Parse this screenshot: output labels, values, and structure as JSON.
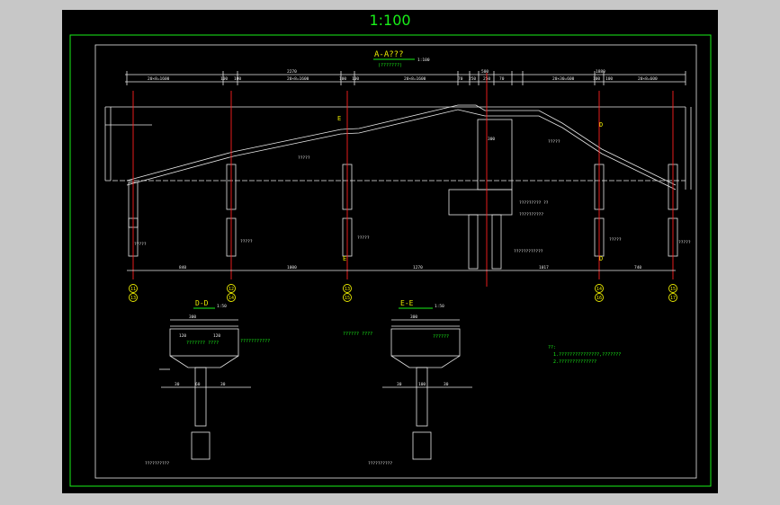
{
  "drawing": {
    "scale_title": "1:100",
    "section_aa": {
      "title": "A-A???",
      "subtitle": "(???????)",
      "scale": "1:100"
    },
    "section_dd": {
      "title": "D-D",
      "scale": "1:50"
    },
    "section_ee": {
      "title": "E-E",
      "scale": "1:50"
    },
    "top_dims": [
      "2270",
      "500",
      "1880"
    ],
    "sub_dims": [
      "20×8=1600",
      "100",
      "100",
      "20×8=1600",
      "100",
      "100",
      "20×8=1600",
      "70",
      "250",
      "250",
      "70",
      "20×30=600",
      "100",
      "100",
      "20×8=600"
    ],
    "bottom_dims": [
      "840",
      "1000",
      "1270",
      "1017",
      "740"
    ],
    "axis_labels": [
      {
        "top": "11",
        "bot": "13"
      },
      {
        "top": "12",
        "bot": "14"
      },
      {
        "top": "13",
        "bot": "15"
      },
      {
        "top": "14",
        "bot": "16"
      },
      {
        "top": "15",
        "bot": "17"
      }
    ],
    "section_marks": [
      "E",
      "E",
      "D",
      "D"
    ],
    "callouts": [
      "?????",
      "?????",
      "?????",
      "?????",
      "?????",
      "????????? ??",
      "??????????",
      "????????????"
    ],
    "dd_callouts": [
      "??????? ????",
      "???????????",
      "??????????"
    ],
    "ee_callouts": [
      "?????? ????",
      "??????",
      "??????????"
    ],
    "notes": {
      "heading": "??:",
      "line1": "1.???????????????,???????",
      "line2": "2.??????????????"
    },
    "dims_small": [
      "300",
      "120",
      "120",
      "30",
      "30",
      "60",
      "100",
      "60",
      "200",
      "400",
      "2.78",
      "2.88"
    ]
  },
  "colors": {
    "background": "#000000",
    "frame": "#19f019",
    "chrome": "#c7c7c7",
    "axis": "#ff2020",
    "label": "#e8e800"
  }
}
